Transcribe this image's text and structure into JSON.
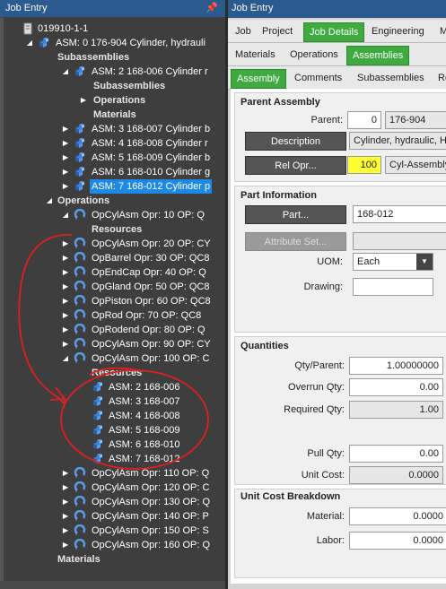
{
  "left_panel": {
    "title": "Job Entry",
    "pin": "↓"
  },
  "tree": {
    "root": "019910-1-1",
    "asm0": "ASM: 0 176-904  Cylinder, hydrauli",
    "subassemblies": "Subassemblies",
    "asm2": "ASM: 2 168-006  Cylinder r",
    "sub2_subassemblies": "Subassemblies",
    "sub2_operations": "Operations",
    "sub2_materials": "Materials",
    "asm3": "ASM: 3 168-007  Cylinder b",
    "asm4": "ASM: 4 168-008  Cylinder r",
    "asm5": "ASM: 5 168-009  Cylinder b",
    "asm6": "ASM: 6 168-010  Cylinder g",
    "asm7": "ASM: 7 168-012  Cylinder p",
    "operations": "Operations",
    "op10": "OpCylAsm   Opr: 10 OP: Q",
    "resources1": "Resources",
    "op20": "OpCylAsm   Opr: 20 OP: CY",
    "op30": "OpBarrel   Opr: 30 OP: QC8",
    "op40": "OpEndCap   Opr: 40 OP: Q",
    "op50": "OpGland   Opr: 50 OP: QC8",
    "op60": "OpPiston   Opr: 60 OP: QC8",
    "op70": "OpRod   Opr: 70 OP: QC8",
    "op80": "OpRodend   Opr: 80 OP: Q",
    "op90": "OpCylAsm   Opr: 90 OP: CY",
    "op100": "OpCylAsm   Opr: 100 OP: C",
    "resources2": "Resources",
    "res_asm2": "ASM: 2 168-006",
    "res_asm3": "ASM: 3 168-007",
    "res_asm4": "ASM: 4 168-008",
    "res_asm5": "ASM: 5 168-009",
    "res_asm6": "ASM: 6 168-010",
    "res_asm7": "ASM: 7 168-012",
    "op110": "OpCylAsm   Opr: 110 OP: Q",
    "op120": "OpCylAsm   Opr: 120 OP: C",
    "op130": "OpCylAsm   Opr: 130 OP: Q",
    "op140": "OpCylAsm   Opr: 140 OP: P",
    "op150": "OpCylAsm   Opr: 150 OP: S",
    "op160": "OpCylAsm   Opr: 160 OP: Q",
    "materials": "Materials"
  },
  "right_panel": {
    "title": "Job Entry",
    "tabs1": [
      "Job",
      "Project",
      "Job Details",
      "Engineering",
      "M"
    ],
    "tabs2": [
      "Materials",
      "Operations",
      "Assemblies"
    ],
    "tabs3": [
      "Assembly",
      "Comments",
      "Subassemblies",
      "Ro"
    ]
  },
  "parent_assembly": {
    "title": "Parent Assembly",
    "parent_label": "Parent:",
    "parent_seq": "0",
    "parent_part": "176-904",
    "description_btn": "Description",
    "description_value": "Cylinder, hydraulic, H",
    "relop_btn": "Rel Opr...",
    "relop_value": "100",
    "relop_desc": "Cyl-Assembly"
  },
  "part_information": {
    "title": "Part Information",
    "part_btn": "Part...",
    "part_value": "168-012",
    "attribute_btn": "Attribute Set...",
    "uom_label": "UOM:",
    "uom_value": "Each",
    "drawing_label": "Drawing:",
    "drawing_value": ""
  },
  "quantities": {
    "title": "Quantities",
    "qty_parent_label": "Qty/Parent:",
    "qty_parent_value": "1.00000000",
    "overrun_label": "Overrun Qty:",
    "overrun_value": "0.00",
    "required_label": "Required Qty:",
    "required_value": "1.00",
    "pull_label": "Pull Qty:",
    "pull_value": "0.00",
    "unit_cost_label": "Unit Cost:",
    "unit_cost_value": "0.0000"
  },
  "unit_cost_breakdown": {
    "title": "Unit Cost Breakdown",
    "material_label": "Material:",
    "material_value": "0.0000",
    "labor_label": "Labor:",
    "labor_value": "0.0000"
  },
  "colors": {
    "title_bar": "#2b5a8e",
    "active_tab": "#3faa3f",
    "selection": "#1e88e5",
    "highlight": "#ffff33",
    "annotation": "#e02020"
  },
  "icons": {
    "tree_expand": "chevron-right-icon",
    "tree_collapse": "chevron-down-icon",
    "assembly": "assembly-icon",
    "operation": "operation-icon",
    "resource": "resource-icon"
  }
}
